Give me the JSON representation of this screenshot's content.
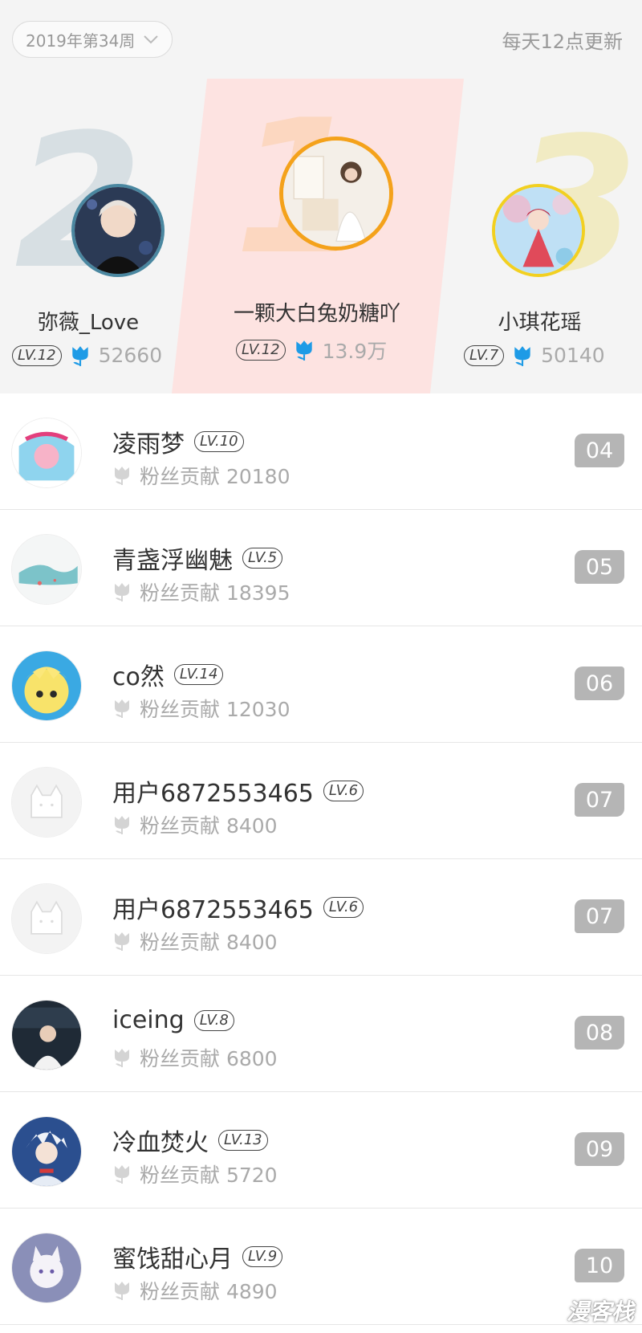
{
  "header": {
    "week_label": "2019年第34周",
    "update_note": "每天12点更新"
  },
  "podium": [
    {
      "rank_num": "2",
      "name": "弥薇_Love",
      "level": "LV.12",
      "count": "52660"
    },
    {
      "rank_num": "1",
      "name": "一颗大白兔奶糖吖",
      "level": "LV.12",
      "count": "13.9万"
    },
    {
      "rank_num": "3",
      "name": "小琪花瑶",
      "level": "LV.7",
      "count": "50140"
    }
  ],
  "list": [
    {
      "name": "凌雨梦",
      "level": "LV.10",
      "contribution": "粉丝贡献 20180",
      "rank": "04"
    },
    {
      "name": "青盏浮幽魅",
      "level": "LV.5",
      "contribution": "粉丝贡献 18395",
      "rank": "05"
    },
    {
      "name": "co然",
      "level": "LV.14",
      "contribution": "粉丝贡献 12030",
      "rank": "06"
    },
    {
      "name": "用户6872553465",
      "level": "LV.6",
      "contribution": "粉丝贡献 8400",
      "rank": "07"
    },
    {
      "name": "用户6872553465",
      "level": "LV.6",
      "contribution": "粉丝贡献 8400",
      "rank": "07"
    },
    {
      "name": "iceing",
      "level": "LV.8",
      "contribution": "粉丝贡献 6800",
      "rank": "08"
    },
    {
      "name": "冷血焚火",
      "level": "LV.13",
      "contribution": "粉丝贡献 5720",
      "rank": "09"
    },
    {
      "name": "蜜饯甜心月",
      "level": "LV.9",
      "contribution": "粉丝贡献 4890",
      "rank": "10"
    }
  ],
  "watermark": "漫客栈",
  "colors": {
    "flower_active": "#1e9be6",
    "flower_inactive": "#d4d4d4",
    "rank_badge": "#b5b5b5",
    "first_place_band": "#fde3e1"
  }
}
